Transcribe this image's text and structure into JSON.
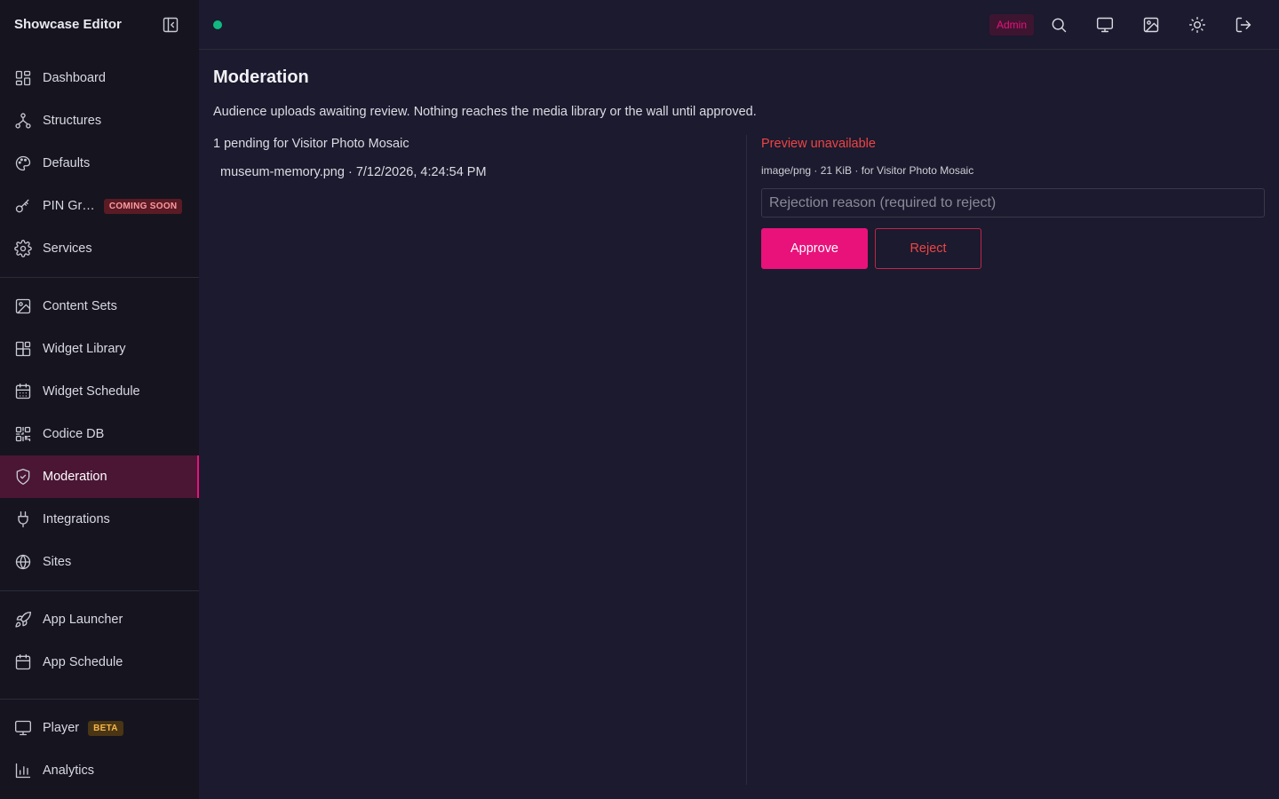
{
  "app": {
    "title": "Showcase Editor"
  },
  "sidebar": {
    "group1": [
      {
        "label": "Dashboard",
        "icon": "dashboard-icon"
      },
      {
        "label": "Structures",
        "icon": "structures-icon"
      },
      {
        "label": "Defaults",
        "icon": "palette-icon"
      },
      {
        "label": "PIN Gr…",
        "icon": "key-icon",
        "badge": "COMING SOON"
      },
      {
        "label": "Services",
        "icon": "gear-icon"
      }
    ],
    "group2": [
      {
        "label": "Content Sets",
        "icon": "image-icon"
      },
      {
        "label": "Widget Library",
        "icon": "widgets-icon"
      },
      {
        "label": "Widget Schedule",
        "icon": "calendar-grid-icon"
      },
      {
        "label": "Codice DB",
        "icon": "qr-icon"
      },
      {
        "label": "Moderation",
        "icon": "shield-check-icon",
        "active": true
      },
      {
        "label": "Integrations",
        "icon": "plug-icon"
      },
      {
        "label": "Sites",
        "icon": "globe-icon"
      }
    ],
    "group3": [
      {
        "label": "App Launcher",
        "icon": "rocket-icon"
      },
      {
        "label": "App Schedule",
        "icon": "calendar-icon"
      }
    ],
    "group4": [
      {
        "label": "Player",
        "icon": "monitor-icon",
        "badge": "BETA"
      },
      {
        "label": "Analytics",
        "icon": "bar-chart-icon"
      }
    ]
  },
  "topbar": {
    "status_color": "#10b981",
    "role_label": "Admin",
    "icons": [
      "search-icon",
      "monitor-icon",
      "image-icon",
      "sun-icon",
      "logout-icon"
    ]
  },
  "main": {
    "title": "Moderation",
    "description": "Audience uploads awaiting review. Nothing reaches the media library or the wall until approved.",
    "pending_count": "1 pending for Visitor Photo Mosaic",
    "uploads": [
      {
        "name": "museum-memory.png · 7/12/2026, 4:24:54 PM"
      }
    ],
    "detail": {
      "preview_error": "Preview unavailable",
      "meta": "image/png · 21 KiB · for Visitor Photo Mosaic",
      "reason_placeholder": "Rejection reason (required to reject)",
      "approve_label": "Approve",
      "reject_label": "Reject"
    }
  },
  "colors": {
    "accent": "#e8127a",
    "danger": "#ef4444",
    "success": "#10b981"
  }
}
